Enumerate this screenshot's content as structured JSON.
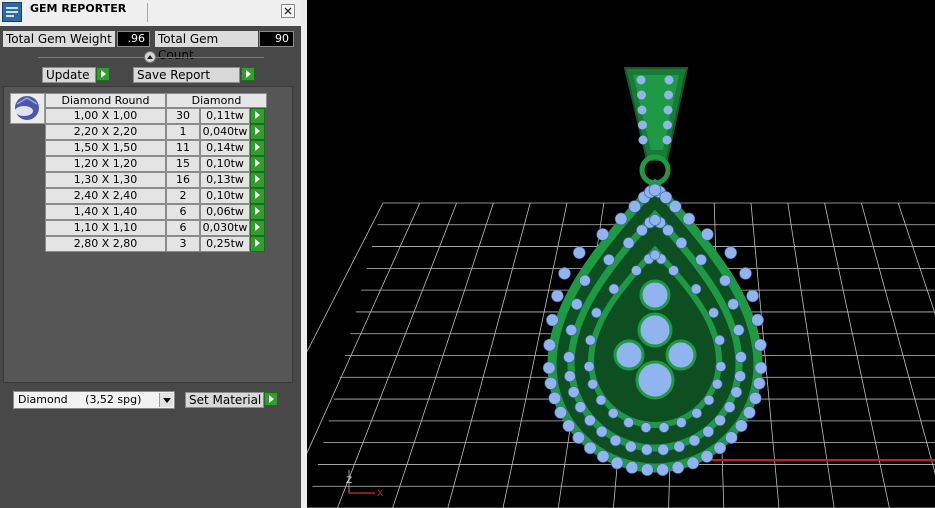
{
  "window": {
    "title": "GEM REPORTER"
  },
  "stats": {
    "total_weight_label": "Total Gem Weight",
    "total_weight_value": ".96",
    "total_count_label": "Total Gem Count",
    "total_count_value": "90"
  },
  "actions": {
    "update_label": "Update",
    "save_report_label": "Save Report"
  },
  "gem_table": {
    "headers": [
      "Diamond Round",
      "Diamond"
    ],
    "rows": [
      {
        "size": "1,00 X 1,00",
        "count": "30",
        "weight": "0,11tw"
      },
      {
        "size": "2,20 X 2,20",
        "count": "1",
        "weight": "0,040tw"
      },
      {
        "size": "1,50 X 1,50",
        "count": "11",
        "weight": "0,14tw"
      },
      {
        "size": "1,20 X 1,20",
        "count": "15",
        "weight": "0,10tw"
      },
      {
        "size": "1,30 X 1,30",
        "count": "16",
        "weight": "0,13tw"
      },
      {
        "size": "2,40 X 2,40",
        "count": "2",
        "weight": "0,10tw"
      },
      {
        "size": "1,40 X 1,40",
        "count": "6",
        "weight": "0,06tw"
      },
      {
        "size": "1,10 X 1,10",
        "count": "6",
        "weight": "0,030tw"
      },
      {
        "size": "2,80 X 2,80",
        "count": "3",
        "weight": "0,25tw"
      }
    ]
  },
  "material": {
    "selected": "Diamond     (3,52 spg)",
    "set_material_label": "Set Material"
  },
  "viewport": {
    "axis_z_label": "Z",
    "axis_x_label": "X",
    "metal_color": "#1f9a44",
    "gem_color": "#8fb4ee",
    "grid_color": "#bdbdbd",
    "accent_axis_color": "#c4211f"
  },
  "icons": [
    "app-icon",
    "close-icon",
    "collapse-icon",
    "gem-thumbnail",
    "play-arrow-icon",
    "dropdown-arrow-icon"
  ]
}
